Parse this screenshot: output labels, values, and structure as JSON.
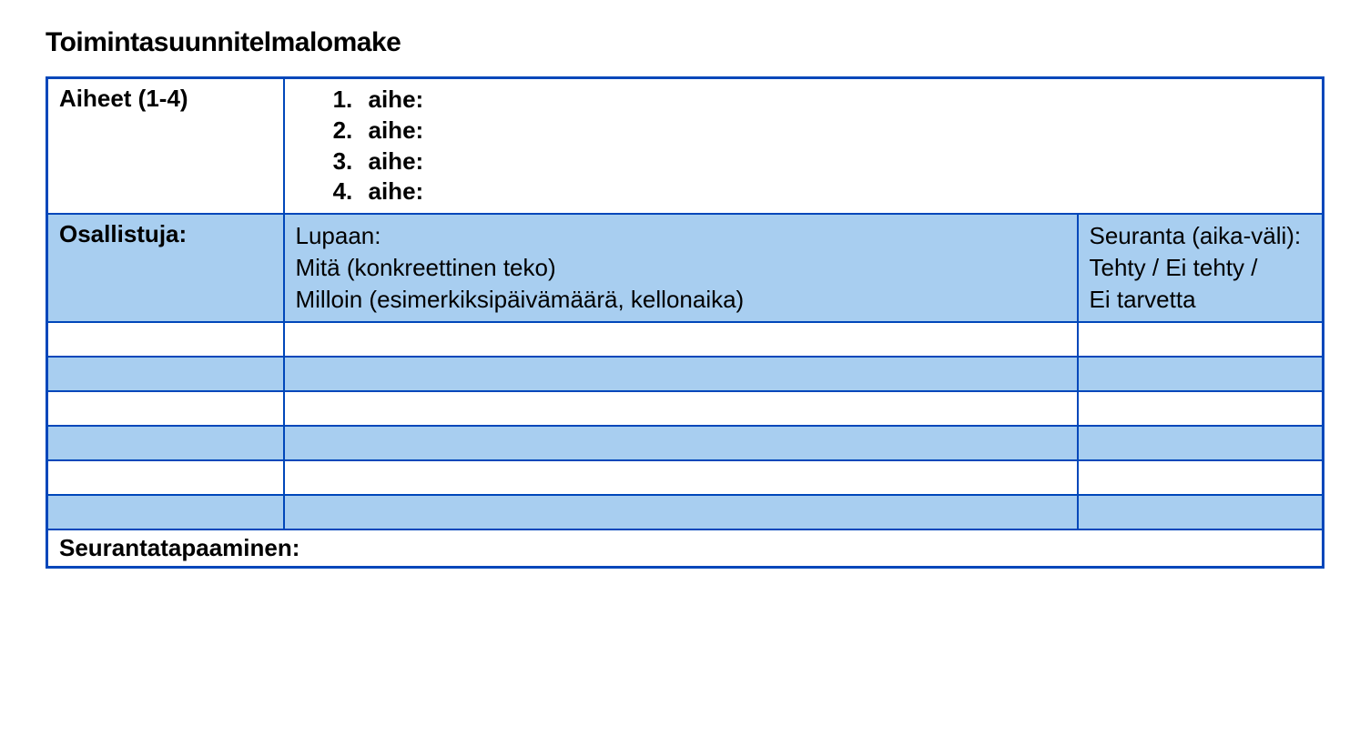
{
  "title": "Toimintasuunnitelmalomake",
  "table": {
    "topicsLabel": "Aiheet (1-4)",
    "topics": {
      "item1": "aihe:",
      "item2": "aihe:",
      "item3": "aihe:",
      "item4": "aihe:"
    },
    "participantLabel": "Osallistuja:",
    "promiseHeader": {
      "line1": "Lupaan:",
      "line2": "Mitä (konkreettinen teko)",
      "line3": "Milloin (esimerkiksipäivämäärä, kellonaika)"
    },
    "followupHeader": {
      "line1": "Seuranta (aika-väli):",
      "line2": "Tehty / Ei tehty /",
      "line3": "Ei tarvetta"
    },
    "footerLabel": "Seurantatapaaminen:"
  }
}
